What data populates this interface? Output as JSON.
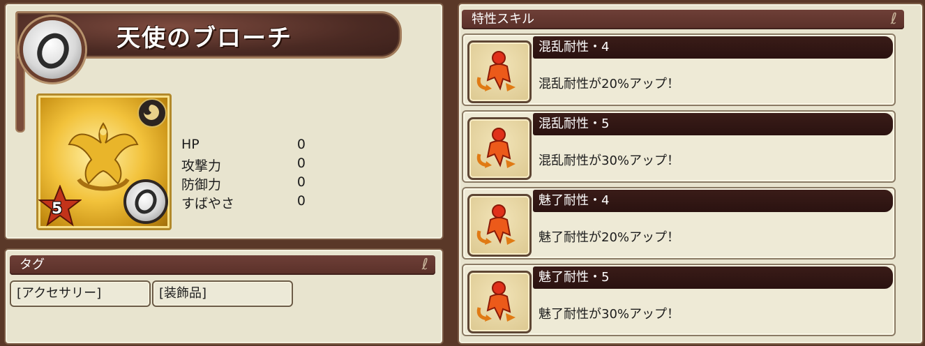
{
  "item": {
    "name": "天使のブローチ",
    "rarity": "5",
    "stats": [
      {
        "label": "HP",
        "value": "0"
      },
      {
        "label": "攻撃力",
        "value": "0"
      },
      {
        "label": "防御力",
        "value": "0"
      },
      {
        "label": "すばやさ",
        "value": "0"
      }
    ]
  },
  "tags": {
    "title": "タグ",
    "items": [
      "[アクセサリー]",
      "[装飾品]"
    ]
  },
  "skills": {
    "title": "特性スキル",
    "items": [
      {
        "name": "混乱耐性・4",
        "desc": "混乱耐性が20%アップ！",
        "icon": "confusion-resist-icon"
      },
      {
        "name": "混乱耐性・5",
        "desc": "混乱耐性が30%アップ！",
        "icon": "confusion-resist-icon"
      },
      {
        "name": "魅了耐性・4",
        "desc": "魅了耐性が20%アップ！",
        "icon": "charm-resist-icon"
      },
      {
        "name": "魅了耐性・5",
        "desc": "魅了耐性が30%アップ！",
        "icon": "charm-resist-icon"
      }
    ]
  },
  "colors": {
    "background": "#5a3828",
    "panel": "#e8e4cf",
    "header": "#6e3f37",
    "skill_title": "#2a1210"
  }
}
